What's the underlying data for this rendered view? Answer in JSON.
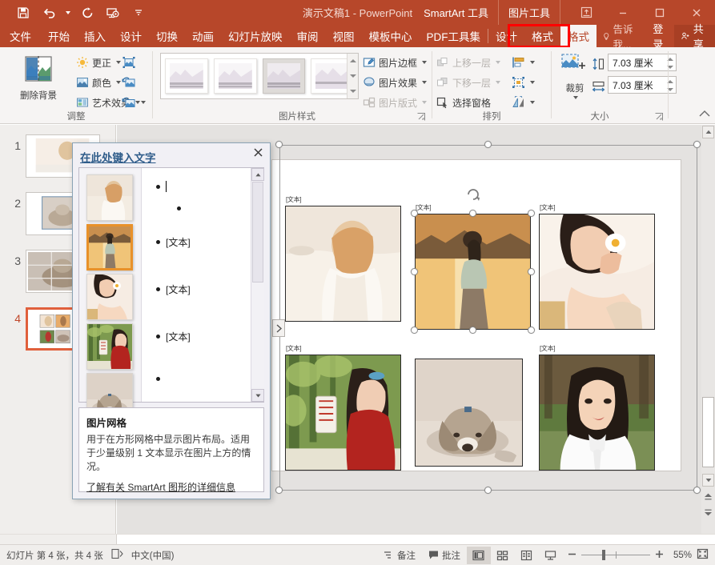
{
  "titlebar": {
    "document_title": "演示文稿1 - PowerPoint",
    "qat": [
      {
        "name": "save-icon",
        "label": "保存"
      },
      {
        "name": "undo-icon",
        "label": "撤消"
      },
      {
        "name": "redo-icon",
        "label": "重复"
      },
      {
        "name": "start-slideshow-icon",
        "label": "从头开始"
      },
      {
        "name": "customize-qat-icon",
        "label": "自定义快速访问工具栏"
      }
    ],
    "context_tabs": [
      {
        "label": "SmartArt 工具"
      },
      {
        "label": "图片工具"
      }
    ],
    "window_buttons": [
      {
        "name": "ribbon-display-options-icon",
        "glyph": "⬜"
      },
      {
        "name": "minimize-icon",
        "glyph": "–"
      },
      {
        "name": "maximize-icon",
        "glyph": "☐"
      },
      {
        "name": "close-icon",
        "glyph": "✕"
      }
    ]
  },
  "ribbon_tabs": {
    "items": [
      {
        "label": "文件",
        "active": false
      },
      {
        "label": "开始",
        "active": false
      },
      {
        "label": "插入",
        "active": false
      },
      {
        "label": "设计",
        "active": false
      },
      {
        "label": "切换",
        "active": false
      },
      {
        "label": "动画",
        "active": false
      },
      {
        "label": "幻灯片放映",
        "active": false
      },
      {
        "label": "审阅",
        "active": false
      },
      {
        "label": "视图",
        "active": false
      },
      {
        "label": "模板中心",
        "active": false
      },
      {
        "label": "PDF工具集",
        "active": false
      },
      {
        "label": "设计",
        "active": false
      },
      {
        "label": "格式",
        "active": false
      },
      {
        "label": "格式",
        "active": true
      }
    ],
    "tell_me": "告诉我...",
    "sign_in": "登录",
    "share": "共享",
    "active_tab_highlight_color": "#ff0000"
  },
  "ribbon": {
    "groups": [
      {
        "name": "adjust",
        "label": "调整",
        "remove_background": "删除背景",
        "buttons": [
          {
            "label": "更正",
            "icon": "corrections-icon",
            "has_caret": true
          },
          {
            "label": "颜色",
            "icon": "color-icon",
            "has_caret": true
          },
          {
            "label": "艺术效果",
            "icon": "artistic-effects-icon",
            "has_caret": true
          }
        ],
        "icon_buttons": [
          {
            "icon": "compress-pictures-icon"
          },
          {
            "icon": "change-picture-icon"
          },
          {
            "icon": "reset-picture-icon",
            "has_caret": true
          }
        ]
      },
      {
        "name": "picture-styles",
        "label": "图片样式",
        "gallery_items": [
          {
            "name": "style-1",
            "selected": false
          },
          {
            "name": "style-2",
            "selected": false
          },
          {
            "name": "style-3",
            "selected": true
          },
          {
            "name": "style-4",
            "selected": false
          }
        ],
        "buttons": [
          {
            "label": "图片边框",
            "icon": "picture-border-icon",
            "has_caret": true,
            "disabled": false
          },
          {
            "label": "图片效果",
            "icon": "picture-effects-icon",
            "has_caret": true,
            "disabled": false
          },
          {
            "label": "图片版式",
            "icon": "picture-layout-icon",
            "has_caret": true,
            "disabled": true,
            "highlighted": true
          }
        ]
      },
      {
        "name": "arrange",
        "label": "排列",
        "buttons": [
          {
            "label": "上移一层",
            "icon": "bring-forward-icon",
            "has_caret": true,
            "disabled": true
          },
          {
            "label": "下移一层",
            "icon": "send-backward-icon",
            "has_caret": true,
            "disabled": true
          },
          {
            "label": "选择窗格",
            "icon": "selection-pane-icon",
            "has_caret": false,
            "disabled": false
          }
        ],
        "icon_buttons": [
          {
            "icon": "align-icon",
            "has_caret": true
          },
          {
            "icon": "group-icon",
            "has_caret": true
          },
          {
            "icon": "rotate-icon",
            "has_caret": true
          }
        ]
      },
      {
        "name": "size",
        "label": "大小",
        "crop_label": "裁剪",
        "crop_icon": "crop-icon",
        "height": {
          "icon": "shape-height-icon",
          "value": "7.03 厘米"
        },
        "width": {
          "icon": "shape-width-icon",
          "value": "7.03 厘米"
        }
      }
    ],
    "collapse_icon": "collapse-ribbon-icon"
  },
  "thumbnails": {
    "slides": [
      {
        "number": "1",
        "active": false
      },
      {
        "number": "2",
        "active": false
      },
      {
        "number": "3",
        "active": false
      },
      {
        "number": "4",
        "active": true
      }
    ]
  },
  "slide": {
    "smartart_cells": [
      {
        "label": "[文本]",
        "selected": false,
        "name": "smartart-picture-1"
      },
      {
        "label": "[文本]",
        "selected": true,
        "name": "smartart-picture-2"
      },
      {
        "label": "[文本]",
        "selected": false,
        "name": "smartart-picture-3"
      },
      {
        "label": "[文本]",
        "selected": false,
        "name": "smartart-picture-4"
      },
      {
        "label": "",
        "selected": false,
        "name": "smartart-picture-5"
      },
      {
        "label": "[文本]",
        "selected": false,
        "name": "smartart-picture-6"
      }
    ],
    "expand_arrow_icon": "expand-text-pane-icon",
    "rotate_handle_icon": "rotate-handle-icon"
  },
  "text_pane": {
    "title": "在此处键入文字",
    "close_icon": "close-icon",
    "thumbnails": [
      {
        "selected": false,
        "name": "text-pane-thumb-1"
      },
      {
        "selected": true,
        "name": "text-pane-thumb-2"
      },
      {
        "selected": false,
        "name": "text-pane-thumb-3"
      },
      {
        "selected": false,
        "name": "text-pane-thumb-4"
      },
      {
        "selected": false,
        "name": "text-pane-thumb-5"
      }
    ],
    "bullets": [
      {
        "text": "",
        "level": 1,
        "has_cursor": true
      },
      {
        "text": "",
        "level": 2,
        "has_cursor": false
      },
      {
        "text": "[文本]",
        "level": 1,
        "has_cursor": false
      },
      {
        "text": "[文本]",
        "level": 1,
        "has_cursor": false
      },
      {
        "text": "[文本]",
        "level": 1,
        "has_cursor": false
      },
      {
        "text": "",
        "level": 1,
        "has_cursor": false
      }
    ],
    "description": {
      "title": "图片网格",
      "body": "用于在方形网格中显示图片布局。适用于少量级别 1 文本显示在图片上方的情况。",
      "link": "了解有关 SmartArt 图形的详细信息"
    }
  },
  "statusbar": {
    "slide_count": "幻灯片 第 4 张，共 4 张",
    "accessibility_icon": "accessibility-icon",
    "language": "中文(中国)",
    "notes": "备注",
    "comments": "批注",
    "views": [
      {
        "name": "normal-view-icon",
        "active": true
      },
      {
        "name": "slide-sorter-view-icon",
        "active": false
      },
      {
        "name": "reading-view-icon",
        "active": false
      },
      {
        "name": "slideshow-view-icon",
        "active": false
      }
    ],
    "zoom_out_icon": "zoom-out-icon",
    "zoom_in_icon": "zoom-in-icon",
    "zoom_level": "55%",
    "fit_slide_icon": "fit-slide-to-window-icon"
  },
  "colors": {
    "accent": "#b7472a",
    "highlight": "#ff0000",
    "selection_orange": "#e8912a",
    "active_slide_border": "#e0603c"
  }
}
